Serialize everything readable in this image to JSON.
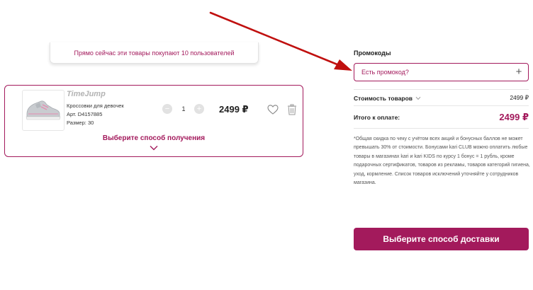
{
  "notice": {
    "text": "Прямо сейчас эти товары покупают 10 пользователей"
  },
  "cart_item": {
    "brand": "TimeJump",
    "product_name": "Кроссовки для девочек",
    "article": "Арт. D4157885",
    "size": "Размер: 30",
    "quantity": "1",
    "minus_label": "−",
    "plus_label": "+",
    "price": "2499 ₽",
    "delivery_choice": "Выберите способ получения"
  },
  "promo": {
    "label": "Промокоды",
    "placeholder": "Есть промокод?",
    "plus_label": "+"
  },
  "summary": {
    "cost_label": "Стоимость товаров",
    "cost_value": "2499 ₽",
    "total_label": "Итого к оплате:",
    "total_value": "2499 ₽"
  },
  "disclaimer": "*Общая скидка по чеку с учётом всех акций и бонусных баллов не может превышать 30% от стоимости. Бонусами kari CLUB можно оплатить любые товары в магазинах kari и kari KIDS по курсу 1 бонус = 1 рубль, кроме подарочных сертификатов, товаров из рекламы, товаров категорий гигиена, уход, кормление. Список товаров исключений уточняйте у сотрудников магазина.",
  "delivery_button": {
    "label": "Выберите способ доставки"
  },
  "colors": {
    "accent": "#a31a5c",
    "annotation_arrow": "#c0100f",
    "muted": "#b3b3b3",
    "border": "#e6e6e6"
  },
  "icons": [
    "sneaker-image",
    "heart-icon",
    "trash-icon",
    "chevron-down-icon",
    "plus-icon",
    "annotation-arrow"
  ]
}
